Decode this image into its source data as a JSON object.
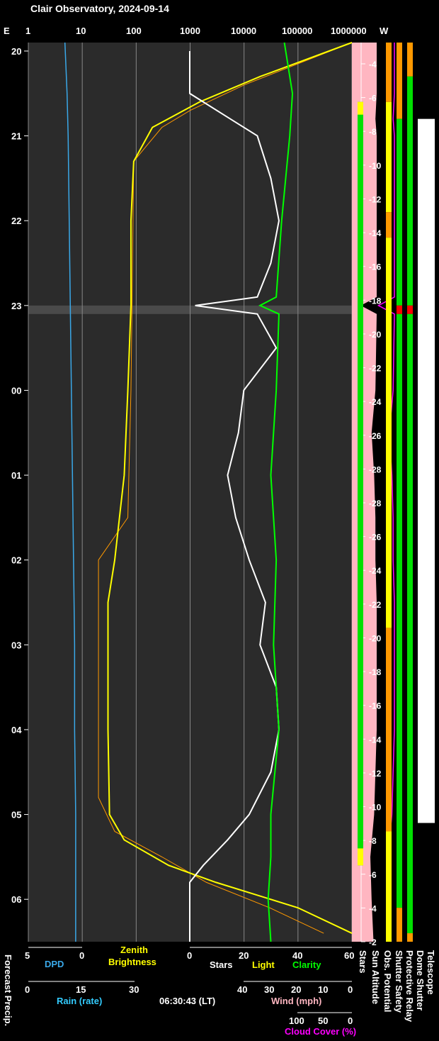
{
  "title": "Clair Observatory, 2024-09-14",
  "colors": {
    "dpd": "#3aa8e8",
    "zenith": "#ffff00",
    "sun_model": "#ff9900",
    "stars": "#ffffff",
    "clarity": "#00ff00",
    "cloud_cover": "#ff00ff",
    "cloud_fill": "#ffb6c1",
    "status_green": "#00e000",
    "status_yellow": "#ffff00",
    "status_orange": "#ff9900",
    "status_red": "#ff0000",
    "rain_label": "#33ccff",
    "wind_label": "#ffb6c1"
  },
  "top_axis": {
    "left_label": "E",
    "right_label": "W",
    "ticks": [
      "1",
      "10",
      "100",
      "1000",
      "10000",
      "100000",
      "1000000"
    ]
  },
  "hour_labels": [
    "20",
    "21",
    "22",
    "23",
    "00",
    "01",
    "02",
    "03",
    "04",
    "05",
    "06"
  ],
  "sun_altitude_labels": [
    "-4",
    "-6",
    "-8",
    "-10",
    "-12",
    "-14",
    "-16",
    "-18",
    "-20",
    "-22",
    "-24",
    "-26",
    "-28",
    "-28",
    "-26",
    "-24",
    "-22",
    "-20",
    "-18",
    "-16",
    "-14",
    "-12",
    "-10",
    "-8",
    "-6",
    "-4",
    "-2"
  ],
  "bottom_axes": {
    "dpd_ticks": [
      "5",
      "0"
    ],
    "dpd_label": "DPD",
    "zenith_label_1": "Zenith",
    "zenith_label_2": "Brightness",
    "right_ticks": [
      "0",
      "20",
      "40",
      "60"
    ],
    "stars_label": "Stars",
    "light_label": "Light",
    "clarity_label": "Clarity",
    "rain_ticks": [
      "0",
      "15",
      "30"
    ],
    "rain_label": "Rain (rate)",
    "time_label": "06:30:43 (LT)",
    "wind_ticks": [
      "40",
      "30",
      "20",
      "10",
      "0"
    ],
    "wind_label": "Wind (mph)",
    "cloud_ticks": [
      "100",
      "50",
      "0"
    ],
    "cloud_label": "Cloud Cover (%)"
  },
  "side_labels": {
    "forecast_precip": "Forecast Precip.",
    "stars": "Stars",
    "sun_altitude": "Sun Altitude",
    "obs_potential": "Obs. Potential",
    "shutter_safety": "Shutter Safety",
    "protective_relay": "Protective Relay",
    "dome_shutter": "Dome Shutter",
    "telescope": "Telescope"
  },
  "chart_data": {
    "type": "line",
    "title": "Clair Observatory, 2024-09-14",
    "time_range_hours": [
      19.9,
      30.5
    ],
    "hour_ticks": [
      20,
      21,
      22,
      23,
      24,
      25,
      26,
      27,
      28,
      29,
      30
    ],
    "zenith_brightness_log": {
      "axis": "log",
      "range": [
        1,
        1000000
      ],
      "points": [
        [
          19.9,
          1000000
        ],
        [
          20.3,
          20000
        ],
        [
          20.6,
          1500
        ],
        [
          20.9,
          200
        ],
        [
          21.3,
          90
        ],
        [
          22.0,
          80
        ],
        [
          23.0,
          80
        ],
        [
          24.0,
          70
        ],
        [
          25.0,
          60
        ],
        [
          26.0,
          40
        ],
        [
          26.5,
          30
        ],
        [
          27.0,
          30
        ],
        [
          28.0,
          30
        ],
        [
          29.0,
          32
        ],
        [
          29.3,
          60
        ],
        [
          29.6,
          400
        ],
        [
          29.8,
          3000
        ],
        [
          30.1,
          100000
        ],
        [
          30.4,
          1000000
        ]
      ]
    },
    "sun_model_brightness_log": {
      "axis": "log",
      "range": [
        1,
        1000000
      ],
      "points": [
        [
          19.9,
          1000000
        ],
        [
          20.4,
          10000
        ],
        [
          20.7,
          1000
        ],
        [
          20.9,
          300
        ],
        [
          21.3,
          90
        ],
        [
          24.0,
          80
        ],
        [
          25.5,
          70
        ],
        [
          26.0,
          20
        ],
        [
          28.8,
          20
        ],
        [
          29.2,
          40
        ],
        [
          29.5,
          300
        ],
        [
          29.8,
          2000
        ],
        [
          30.1,
          30000
        ],
        [
          30.4,
          300000
        ]
      ]
    },
    "stars": {
      "range": [
        0,
        60
      ],
      "points": [
        [
          20.0,
          0
        ],
        [
          20.5,
          0
        ],
        [
          20.6,
          5
        ],
        [
          20.8,
          15
        ],
        [
          21.0,
          25
        ],
        [
          21.5,
          30
        ],
        [
          22.0,
          33
        ],
        [
          22.5,
          30
        ],
        [
          22.9,
          25
        ],
        [
          23.0,
          2
        ],
        [
          23.1,
          25
        ],
        [
          23.5,
          32
        ],
        [
          24.0,
          20
        ],
        [
          24.5,
          18
        ],
        [
          25.0,
          14
        ],
        [
          25.5,
          17
        ],
        [
          26.0,
          22
        ],
        [
          26.5,
          28
        ],
        [
          27.0,
          26
        ],
        [
          27.5,
          32
        ],
        [
          28.0,
          33
        ],
        [
          28.5,
          30
        ],
        [
          29.0,
          22
        ],
        [
          29.3,
          14
        ],
        [
          29.6,
          5
        ],
        [
          29.8,
          0
        ],
        [
          30.5,
          0
        ]
      ]
    },
    "clarity": {
      "range": [
        0,
        60
      ],
      "points": [
        [
          19.9,
          35
        ],
        [
          20.5,
          38
        ],
        [
          21.0,
          37
        ],
        [
          22.0,
          34
        ],
        [
          22.9,
          32
        ],
        [
          23.0,
          26
        ],
        [
          23.1,
          33
        ],
        [
          24.0,
          32
        ],
        [
          25.0,
          30
        ],
        [
          26.0,
          32
        ],
        [
          27.0,
          31
        ],
        [
          28.0,
          33
        ],
        [
          29.0,
          30
        ],
        [
          29.5,
          30
        ],
        [
          30.0,
          29
        ],
        [
          30.5,
          30
        ]
      ]
    },
    "dpd": {
      "range": [
        5,
        0
      ],
      "points": [
        [
          19.9,
          1.6
        ],
        [
          20.5,
          1.4
        ],
        [
          21.0,
          1.3
        ],
        [
          22.0,
          1.2
        ],
        [
          23.0,
          1.1
        ],
        [
          24.0,
          1.0
        ],
        [
          25.0,
          0.9
        ],
        [
          26.0,
          0.8
        ],
        [
          27.0,
          0.7
        ],
        [
          28.0,
          0.7
        ],
        [
          29.0,
          0.6
        ],
        [
          30.0,
          0.6
        ],
        [
          30.5,
          0.6
        ]
      ]
    },
    "cloud_cover": {
      "range": [
        100,
        0
      ],
      "points": [
        [
          19.9,
          0
        ],
        [
          20.5,
          0
        ],
        [
          20.8,
          2
        ],
        [
          21.0,
          0
        ],
        [
          22.9,
          0
        ],
        [
          23.0,
          25
        ],
        [
          23.1,
          0
        ],
        [
          24.0,
          2
        ],
        [
          24.5,
          8
        ],
        [
          25.0,
          4
        ],
        [
          25.5,
          2
        ],
        [
          26.0,
          2
        ],
        [
          26.5,
          0
        ],
        [
          28.0,
          0
        ],
        [
          29.0,
          4
        ],
        [
          29.5,
          10
        ],
        [
          30.0,
          8
        ],
        [
          30.5,
          5
        ]
      ]
    },
    "status_segments": {
      "obs_potential": [
        [
          "orange",
          19.9,
          20.6
        ],
        [
          "yellow",
          20.6,
          21.9
        ],
        [
          "orange",
          21.9,
          22.2
        ],
        [
          "yellow",
          22.2,
          26.8
        ],
        [
          "orange",
          26.8,
          29.2
        ],
        [
          "yellow",
          29.2,
          30.5
        ]
      ],
      "shutter_safety": [
        [
          "orange",
          19.9,
          20.8
        ],
        [
          "green",
          20.8,
          23.0
        ],
        [
          "red",
          23.0,
          23.1
        ],
        [
          "green",
          23.1,
          30.1
        ],
        [
          "orange",
          30.1,
          30.5
        ]
      ],
      "protective_relay": [
        [
          "orange",
          19.9,
          20.3
        ],
        [
          "green",
          20.3,
          23.0
        ],
        [
          "red",
          23.0,
          23.1
        ],
        [
          "green",
          23.1,
          30.4
        ],
        [
          "orange",
          30.4,
          30.5
        ]
      ]
    }
  }
}
